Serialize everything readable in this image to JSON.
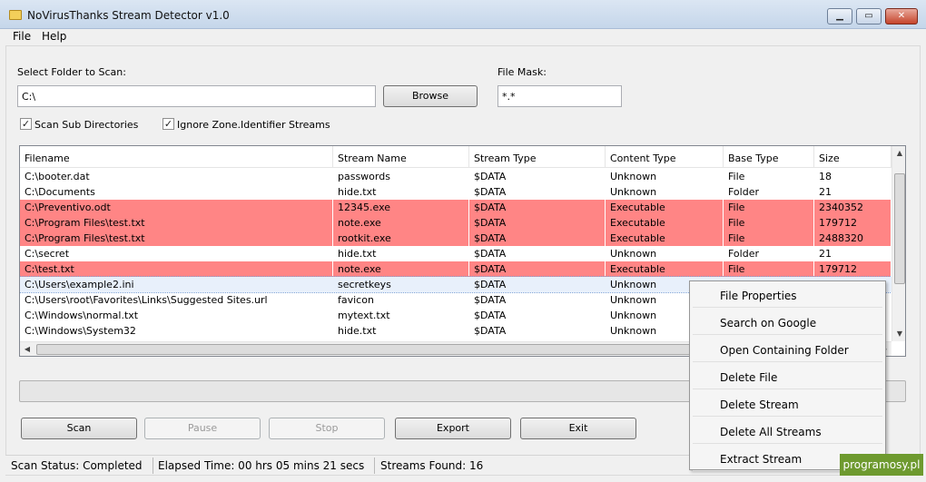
{
  "window": {
    "title": "NoVirusThanks Stream Detector v1.0"
  },
  "menu": {
    "file": "File",
    "help": "Help"
  },
  "folder": {
    "label": "Select Folder to Scan:",
    "value": "C:\\",
    "browse": "Browse"
  },
  "mask": {
    "label": "File Mask:",
    "value": "*.*"
  },
  "options": {
    "scan_sub": "Scan Sub Directories",
    "ignore_zone": "Ignore Zone.Identifier Streams"
  },
  "columns": [
    "Filename",
    "Stream Name",
    "Stream Type",
    "Content Type",
    "Base Type",
    "Size"
  ],
  "rows": [
    {
      "filename": "C:\\booter.dat",
      "stream": "passwords",
      "type": "$DATA",
      "content": "Unknown",
      "base": "File",
      "size": "18",
      "flag": "normal"
    },
    {
      "filename": "C:\\Documents",
      "stream": "hide.txt",
      "type": "$DATA",
      "content": "Unknown",
      "base": "Folder",
      "size": "21",
      "flag": "normal"
    },
    {
      "filename": "C:\\Preventivo.odt",
      "stream": "12345.exe",
      "type": "$DATA",
      "content": "Executable",
      "base": "File",
      "size": "2340352",
      "flag": "danger"
    },
    {
      "filename": "C:\\Program Files\\test.txt",
      "stream": "note.exe",
      "type": "$DATA",
      "content": "Executable",
      "base": "File",
      "size": "179712",
      "flag": "danger"
    },
    {
      "filename": "C:\\Program Files\\test.txt",
      "stream": "rootkit.exe",
      "type": "$DATA",
      "content": "Executable",
      "base": "File",
      "size": "2488320",
      "flag": "danger"
    },
    {
      "filename": "C:\\secret",
      "stream": "hide.txt",
      "type": "$DATA",
      "content": "Unknown",
      "base": "Folder",
      "size": "21",
      "flag": "normal"
    },
    {
      "filename": "C:\\test.txt",
      "stream": "note.exe",
      "type": "$DATA",
      "content": "Executable",
      "base": "File",
      "size": "179712",
      "flag": "danger"
    },
    {
      "filename": "C:\\Users\\example2.ini",
      "stream": "secretkeys",
      "type": "$DATA",
      "content": "Unknown",
      "base": "",
      "size": "",
      "flag": "selected"
    },
    {
      "filename": "C:\\Users\\root\\Favorites\\Links\\Suggested Sites.url",
      "stream": "favicon",
      "type": "$DATA",
      "content": "Unknown",
      "base": "",
      "size": "",
      "flag": "normal"
    },
    {
      "filename": "C:\\Windows\\normal.txt",
      "stream": "mytext.txt",
      "type": "$DATA",
      "content": "Unknown",
      "base": "",
      "size": "",
      "flag": "normal"
    },
    {
      "filename": "C:\\Windows\\System32",
      "stream": "hide.txt",
      "type": "$DATA",
      "content": "Unknown",
      "base": "",
      "size": "",
      "flag": "normal"
    }
  ],
  "buttons": {
    "scan": "Scan",
    "pause": "Pause",
    "stop": "Stop",
    "export": "Export",
    "exit": "Exit"
  },
  "status": {
    "scan": "Scan Status: Completed",
    "elapsed": "Elapsed Time: 00 hrs 05 mins 21 secs",
    "found": "Streams Found: 16"
  },
  "context_menu": [
    "File Properties",
    "Search on Google",
    "Open Containing Folder",
    "Delete File",
    "Delete Stream",
    "Delete All Streams",
    "Extract Stream"
  ],
  "progress": {
    "fraction": 0.0
  },
  "watermark": "programosy.pl",
  "colors": {
    "danger_row": "#ff8585",
    "selected_row": "#e8f0fb"
  }
}
